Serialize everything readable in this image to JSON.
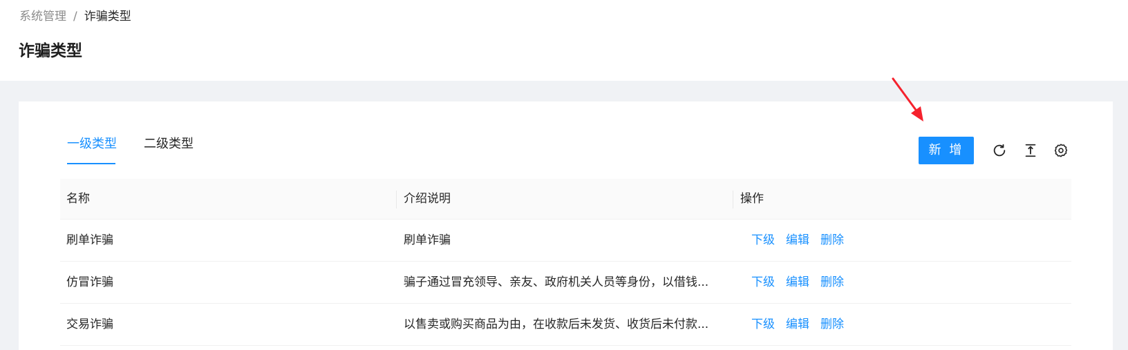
{
  "breadcrumb": {
    "parent": "系统管理",
    "separator": "/",
    "current": "诈骗类型"
  },
  "page_title": "诈骗类型",
  "tabs": [
    {
      "label": "一级类型",
      "active": true
    },
    {
      "label": "二级类型",
      "active": false
    }
  ],
  "toolbar": {
    "add_label": "新 增",
    "icons": [
      "reload-icon",
      "column-height-icon",
      "setting-icon"
    ]
  },
  "table": {
    "columns": [
      "名称",
      "介绍说明",
      "操作"
    ],
    "rows": [
      {
        "name": "刷单诈骗",
        "desc": "刷单诈骗"
      },
      {
        "name": "仿冒诈骗",
        "desc": "骗子通过冒充领导、亲友、政府机关人员等身份，以借钱..."
      },
      {
        "name": "交易诈骗",
        "desc": "以售卖或购买商品为由，在收款后未发货、收货后未付款..."
      }
    ],
    "actions": {
      "sub": "下级",
      "edit": "编辑",
      "delete": "删除"
    }
  },
  "colors": {
    "primary": "#1890ff",
    "annotation_arrow": "#f5222d"
  }
}
